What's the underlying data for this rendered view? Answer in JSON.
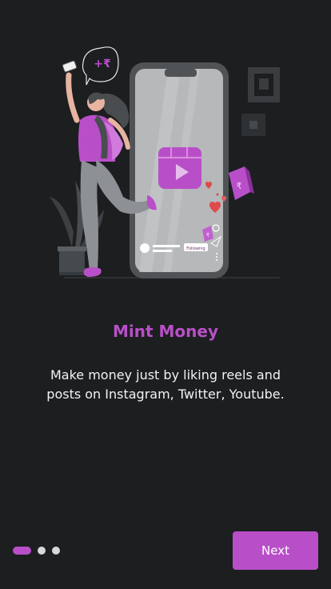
{
  "onboarding": {
    "title": "Mint Money",
    "description": "Make money just by liking reels and posts on Instagram, Twitter, Youtube.",
    "next_label": "Next",
    "page_indicator": {
      "total": 3,
      "current": 1
    },
    "illustration": {
      "speech_bubble_text": "+₹",
      "coin_symbol": "₹",
      "following_label": "Following"
    }
  },
  "colors": {
    "accent": "#b94fc8",
    "background": "#1c1e20",
    "text": "#f2f2f2",
    "dot_inactive": "#d8d8d8"
  }
}
